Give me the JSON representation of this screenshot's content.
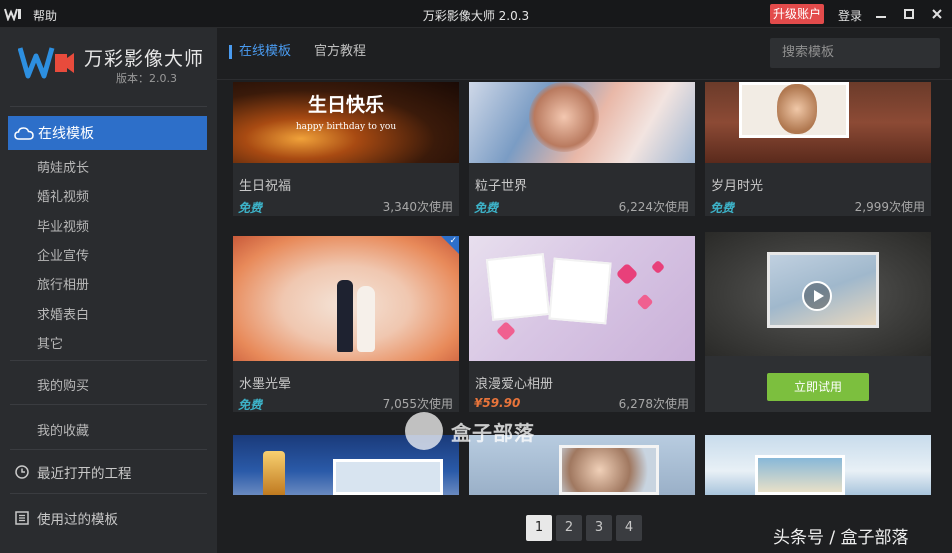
{
  "titlebar": {
    "help": "帮助",
    "title": "万彩影像大师 2.0.3",
    "upgrade": "升级账户",
    "login": "登录"
  },
  "sidebar": {
    "app_name": "万彩影像大师",
    "version": "版本：2.0.3",
    "active": "在线模板",
    "categories": [
      "萌娃成长",
      "婚礼视频",
      "毕业视频",
      "企业宣传",
      "旅行相册",
      "求婚表白",
      "其它"
    ],
    "purchases": "我的购买",
    "favorites": "我的收藏",
    "recent": "最近打开的工程",
    "used": "使用过的模板"
  },
  "main": {
    "tabs": [
      "在线模板",
      "官方教程"
    ],
    "search_placeholder": "搜索模板",
    "cards": [
      {
        "title": "生日祝福",
        "price": "免费",
        "uses": "3,340次使用",
        "overlay": "生日快乐",
        "overlay2": "happy birthday to you"
      },
      {
        "title": "粒子世界",
        "price": "免费",
        "uses": "6,224次使用"
      },
      {
        "title": "岁月时光",
        "price": "免费",
        "uses": "2,999次使用"
      },
      {
        "title": "水墨光晕",
        "price": "免费",
        "uses": "7,055次使用"
      },
      {
        "title": "浪漫爱心相册",
        "price": "¥59.90",
        "uses": "6,278次使用"
      },
      {
        "try_label": "立即试用"
      }
    ],
    "pages": [
      "1",
      "2",
      "3",
      "4"
    ]
  },
  "watermark": "盒子部落",
  "footer_mark": "头条号 / 盒子部落",
  "colors": {
    "accent": "#2d6fc9",
    "free": "#3db3c9",
    "paid": "#e8743b",
    "try": "#7cbf3e",
    "upgrade": "#e34b4b"
  }
}
